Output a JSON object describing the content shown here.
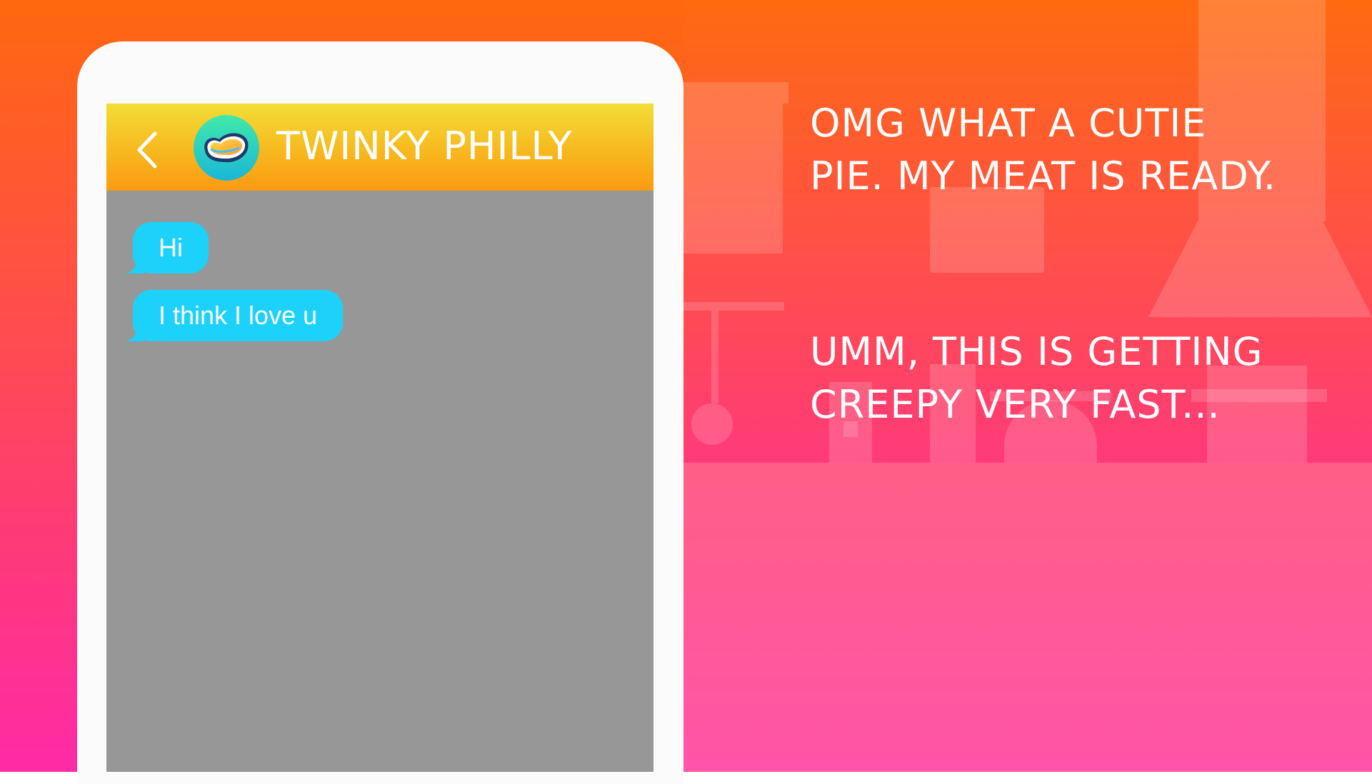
{
  "chat": {
    "contact_name": "TWINKY PHILLY",
    "back_icon": "chevron-left-icon",
    "avatar_icon": "heart-logo-icon",
    "messages": [
      {
        "text": "Hi"
      },
      {
        "text": "I think I love u"
      }
    ]
  },
  "captions": {
    "line1": "OMG WHAT A CUTIE",
    "line2": "PIE. MY MEAT IS READY.",
    "line3": "UMM, THIS IS GETTING",
    "line4": "CREEPY VERY FAST..."
  },
  "colors": {
    "header_top": "#f2de36",
    "header_bottom": "#fb9a12",
    "bubble": "#1cd2fb",
    "screen": "#979797",
    "background_top": "#ff6a10",
    "background_bottom": "#ff30a0"
  }
}
